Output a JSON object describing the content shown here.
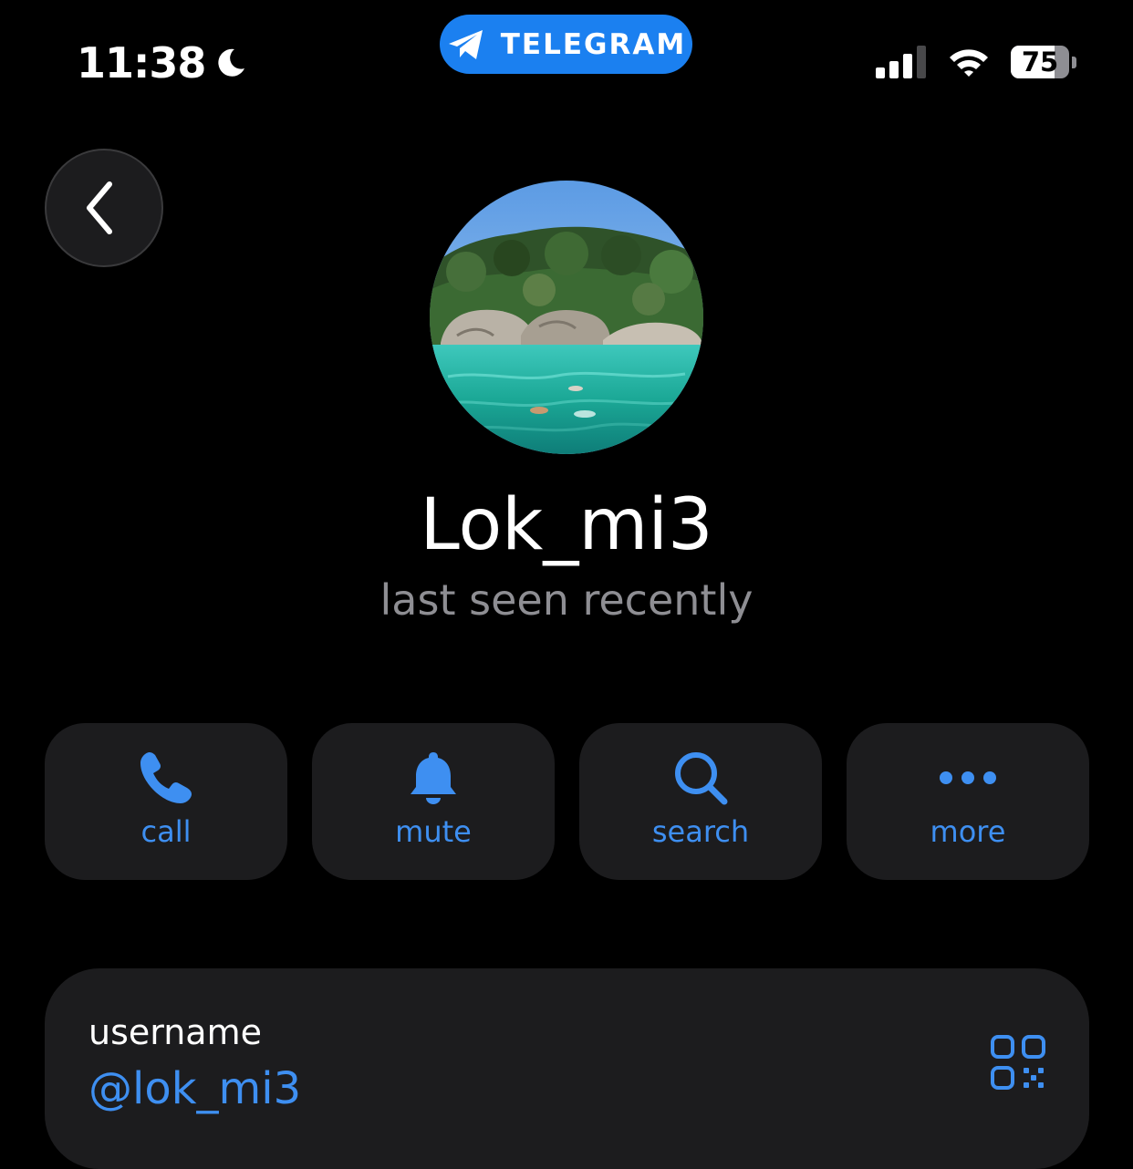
{
  "status_bar": {
    "time": "11:38",
    "focus_icon": "moon-icon",
    "battery_level": "75",
    "battery_fraction": 0.75,
    "signal_bars": 3,
    "signal_bars_total": 4
  },
  "app_pill": {
    "label": "TELEGRAM",
    "icon": "paper-plane-icon",
    "color": "#1b80f0"
  },
  "navigation": {
    "back_icon": "chevron-left-icon"
  },
  "profile": {
    "name": "Lok_mi3",
    "status": "last seen recently",
    "avatar": "tropical-lagoon-photo"
  },
  "actions": [
    {
      "label": "call",
      "icon": "phone-icon"
    },
    {
      "label": "mute",
      "icon": "bell-icon"
    },
    {
      "label": "search",
      "icon": "magnifier-icon"
    },
    {
      "label": "more",
      "icon": "ellipsis-icon"
    }
  ],
  "info": {
    "username_label": "username",
    "username_value": "@lok_mi3",
    "qr_icon": "qr-code-icon"
  },
  "colors": {
    "accent": "#3e8ff1",
    "background": "#000000",
    "card": "#1c1c1e",
    "secondary_text": "#8e8e93"
  }
}
